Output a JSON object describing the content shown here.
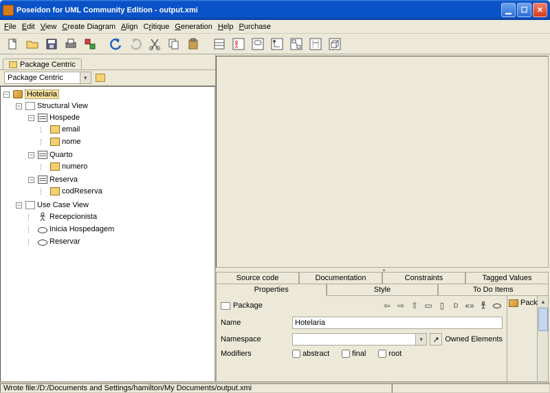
{
  "window": {
    "title": "Poseidon for UML Community Edition - output.xmi"
  },
  "menu": {
    "file": "File",
    "edit": "Edit",
    "view": "View",
    "create_diagram": "Create Diagram",
    "align": "Align",
    "critique": "Critique",
    "generation": "Generation",
    "help": "Help",
    "purchase": "Purchase"
  },
  "left": {
    "tab_label": "Package Centric",
    "view_selector": "Package Centric"
  },
  "tree": {
    "root": "Hotelaria",
    "structural_view": "Structural View",
    "hospede": "Hospede",
    "email": "email",
    "nome": "nome",
    "quarto": "Quarto",
    "numero": "numero",
    "reserva": "Reserva",
    "codreserva": "codReserva",
    "use_case_view": "Use Case View",
    "recepcionista": "Recepcionista",
    "inicia_hospedagem": "Inicia Hospedagem",
    "reservar": "Reservar"
  },
  "tabs": {
    "source_code": "Source code",
    "documentation": "Documentation",
    "constraints": "Constraints",
    "tagged_values": "Tagged Values",
    "properties": "Properties",
    "style": "Style",
    "todo": "To Do Items"
  },
  "properties": {
    "element_type": "Package",
    "name_label": "Name",
    "name_value": "Hotelaria",
    "namespace_label": "Namespace",
    "namespace_value": "",
    "owned_elements": "Owned Elements",
    "modifiers_label": "Modifiers",
    "abstract": "abstract",
    "final": "final",
    "root": "root",
    "right_label": "Pack"
  },
  "status": {
    "text": "Wrote file:/D:/Documents and Settings/hamilton/My Documents/output.xmi"
  }
}
